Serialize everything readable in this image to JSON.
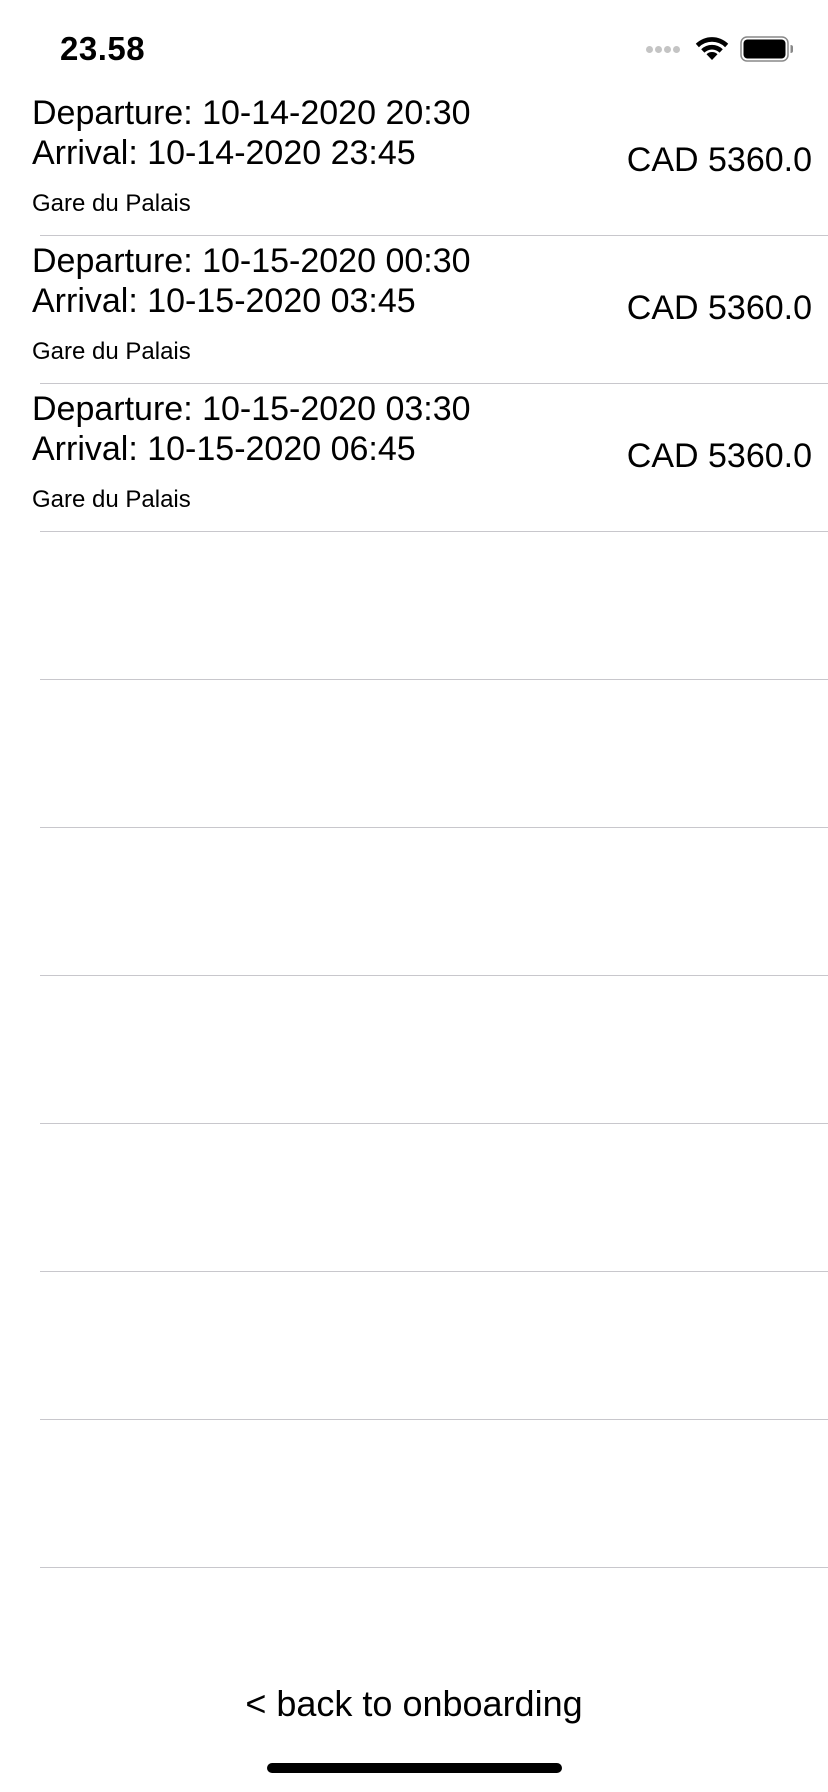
{
  "status_bar": {
    "time": "23.58",
    "icons": [
      "signal-icon",
      "wifi-icon",
      "battery-icon"
    ]
  },
  "trips": [
    {
      "departure": "Departure: 10-14-2020 20:30",
      "arrival": "Arrival: 10-14-2020 23:45",
      "station": "Gare du Palais",
      "price": "CAD 5360.0"
    },
    {
      "departure": "Departure: 10-15-2020 00:30",
      "arrival": "Arrival: 10-15-2020 03:45",
      "station": "Gare du Palais",
      "price": "CAD 5360.0"
    },
    {
      "departure": "Departure: 10-15-2020 03:30",
      "arrival": "Arrival: 10-15-2020 06:45",
      "station": "Gare du Palais",
      "price": "CAD 5360.0"
    }
  ],
  "footer": {
    "back_label": "< back to onboarding"
  },
  "colors": {
    "separator": "#c8c7cc",
    "text": "#000000",
    "background": "#ffffff"
  }
}
